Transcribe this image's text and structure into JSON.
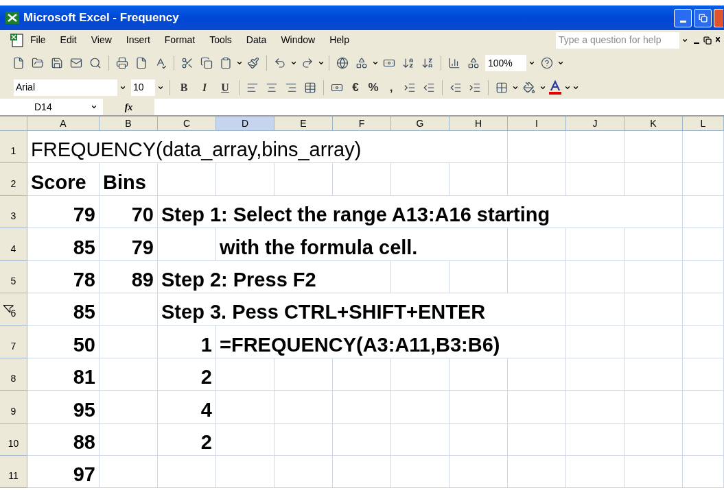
{
  "window": {
    "title": "Microsoft Excel - Frequency"
  },
  "menu_bar": {
    "items": [
      "File",
      "Edit",
      "View",
      "Insert",
      "Format",
      "Tools",
      "Data",
      "Window",
      "Help"
    ],
    "help_box": {
      "placeholder": "Type a question for help"
    }
  },
  "standard_toolbar": {
    "zoom": "100%"
  },
  "formatting_toolbar": {
    "font": "Arial",
    "size": "10",
    "bold": "B",
    "italic": "I",
    "underline": "U",
    "currency": "€",
    "percent": "%",
    "comma": ","
  },
  "formula_bar": {
    "name_box": "D14",
    "fx": "fx"
  },
  "sheet": {
    "columns": [
      {
        "label": "A",
        "selected": false
      },
      {
        "label": "B",
        "selected": false
      },
      {
        "label": "C",
        "selected": false
      },
      {
        "label": "D",
        "selected": true
      },
      {
        "label": "E",
        "selected": false
      },
      {
        "label": "F",
        "selected": false
      },
      {
        "label": "G",
        "selected": false
      },
      {
        "label": "H",
        "selected": false
      },
      {
        "label": "I",
        "selected": false
      },
      {
        "label": "J",
        "selected": false
      },
      {
        "label": "K",
        "selected": false
      },
      {
        "label": "L",
        "selected": false
      }
    ],
    "rows": [
      {
        "header": "1",
        "cells": [
          {
            "kind": "text",
            "text": "FREQUENCY(data_array,bins_array)",
            "bold": false
          }
        ]
      },
      {
        "header": "2",
        "cells": [
          {
            "kind": "text",
            "text": "Score",
            "bold": true
          },
          {
            "kind": "text",
            "text": "Bins",
            "bold": true
          }
        ]
      },
      {
        "header": "3",
        "cells": [
          {
            "kind": "number",
            "text": "79",
            "bold": true
          },
          {
            "kind": "number",
            "text": "70",
            "bold": true
          },
          {
            "kind": "text",
            "text": "Step 1: Select the range A13:A16 starting",
            "bold": true
          }
        ]
      },
      {
        "header": "4",
        "cells": [
          {
            "kind": "number",
            "text": "85",
            "bold": true
          },
          {
            "kind": "number",
            "text": "79",
            "bold": true
          },
          {
            "kind": "empty"
          },
          {
            "kind": "text",
            "text": "with the formula cell.",
            "bold": true
          }
        ]
      },
      {
        "header": "5",
        "cells": [
          {
            "kind": "number",
            "text": "78",
            "bold": true
          },
          {
            "kind": "number",
            "text": "89",
            "bold": true
          },
          {
            "kind": "text",
            "text": "Step 2: Press F2",
            "bold": true
          }
        ]
      },
      {
        "header": "6",
        "cursor": true,
        "cells": [
          {
            "kind": "number",
            "text": "85",
            "bold": true
          },
          {
            "kind": "empty"
          },
          {
            "kind": "text",
            "text": "Step 3. Pess CTRL+SHIFT+ENTER",
            "bold": true
          }
        ]
      },
      {
        "header": "7",
        "cells": [
          {
            "kind": "number",
            "text": "50",
            "bold": true
          },
          {
            "kind": "empty"
          },
          {
            "kind": "number",
            "text": "1",
            "bold": true
          },
          {
            "kind": "text",
            "text": "=FREQUENCY(A3:A11,B3:B6)",
            "bold": true
          }
        ]
      },
      {
        "header": "8",
        "cells": [
          {
            "kind": "number",
            "text": "81",
            "bold": true
          },
          {
            "kind": "empty"
          },
          {
            "kind": "number",
            "text": "2",
            "bold": true
          }
        ]
      },
      {
        "header": "9",
        "cells": [
          {
            "kind": "number",
            "text": "95",
            "bold": true
          },
          {
            "kind": "empty"
          },
          {
            "kind": "number",
            "text": "4",
            "bold": true
          }
        ]
      },
      {
        "header": "10",
        "cells": [
          {
            "kind": "number",
            "text": "88",
            "bold": true
          },
          {
            "kind": "empty"
          },
          {
            "kind": "number",
            "text": "2",
            "bold": true
          }
        ]
      },
      {
        "header": "11",
        "cells": [
          {
            "kind": "number",
            "text": "97",
            "bold": true
          }
        ]
      }
    ]
  }
}
